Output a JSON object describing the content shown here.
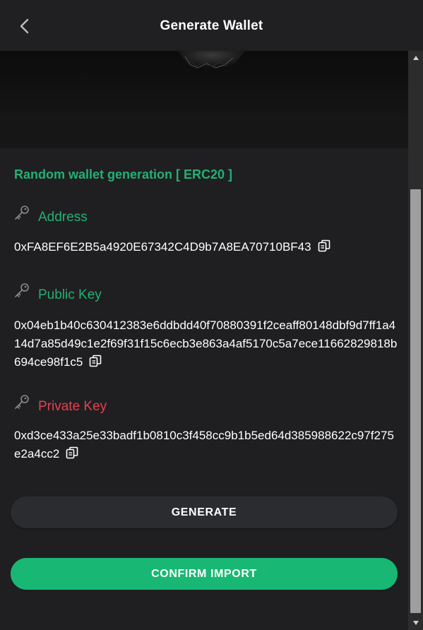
{
  "header": {
    "title": "Generate Wallet",
    "back_icon": "chevron-left-icon"
  },
  "wallet": {
    "section_title": "Random wallet generation [ ERC20 ]",
    "address_label": "Address",
    "address_value": "0xFA8EF6E2B5a4920E67342C4D9b7A8EA70710BF43",
    "public_key_label": "Public Key",
    "public_key_value": "0x04eb1b40c630412383e6ddbdd40f70880391f2ceaff80148dbf9d7ff1a414d7a85d49c1e2f69f31f15c6ecb3e863a4af5170c5a7ece11662829818b694ce98f1c5",
    "private_key_label": "Private Key",
    "private_key_value": "0xd3ce433a25e33badf1b0810c3f458cc9b1b5ed64d385988622c97f275e2a4cc2"
  },
  "actions": {
    "generate_label": "GENERATE",
    "confirm_label": "CONFIRM IMPORT"
  },
  "colors": {
    "accent_green": "#23b074",
    "danger_red": "#e5404f",
    "confirm_button": "#18b874",
    "background": "#1f1f21"
  },
  "icons": {
    "field_icon": "key-icon",
    "copy_icon": "copy-icon"
  }
}
